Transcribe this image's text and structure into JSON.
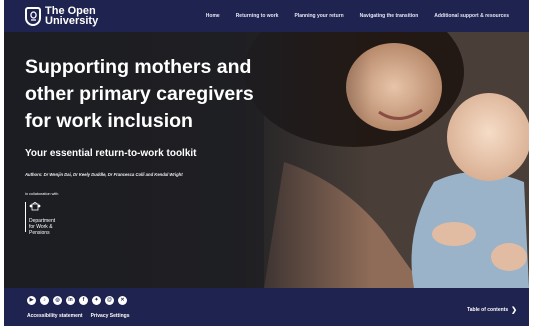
{
  "header": {
    "logo_line1": "The Open",
    "logo_line2": "University",
    "nav": [
      {
        "label": "Home"
      },
      {
        "label": "Returning to work"
      },
      {
        "label": "Planning your return"
      },
      {
        "label": "Navigating the transition"
      },
      {
        "label": "Additional support & resources"
      }
    ]
  },
  "hero": {
    "title_line1": "Supporting mothers and",
    "title_line2": "other primary caregivers",
    "title_line3": "for work inclusion",
    "subtitle": "Your essential return-to-work toolkit",
    "authors": "Authors: Dr Wenjin Dai, Dr Keely Duddle, Dr Francesca Colli and Kendal Wright",
    "collab_label": "in collaboration with",
    "partner": {
      "line1": "Department",
      "line2": "for Work &",
      "line3": "Pensions"
    }
  },
  "footer": {
    "socials": [
      {
        "icon": "youtube-icon",
        "glyph": "▶"
      },
      {
        "icon": "tiktok-icon",
        "glyph": "♪"
      },
      {
        "icon": "instagram-icon",
        "glyph": "◎"
      },
      {
        "icon": "linkedin-icon",
        "glyph": "in"
      },
      {
        "icon": "facebook-icon",
        "glyph": "f"
      },
      {
        "icon": "bluesky-icon",
        "glyph": "✦"
      },
      {
        "icon": "threads-icon",
        "glyph": "@"
      },
      {
        "icon": "x-icon",
        "glyph": "✕"
      }
    ],
    "links": [
      {
        "label": "Accessibility statement"
      },
      {
        "label": "Privacy Settings"
      }
    ],
    "toc_label": "Table of contents",
    "toc_chevron": "❯"
  },
  "colors": {
    "header_bg": "#1f2350",
    "hero_bg": "#23252d",
    "text": "#ffffff"
  }
}
